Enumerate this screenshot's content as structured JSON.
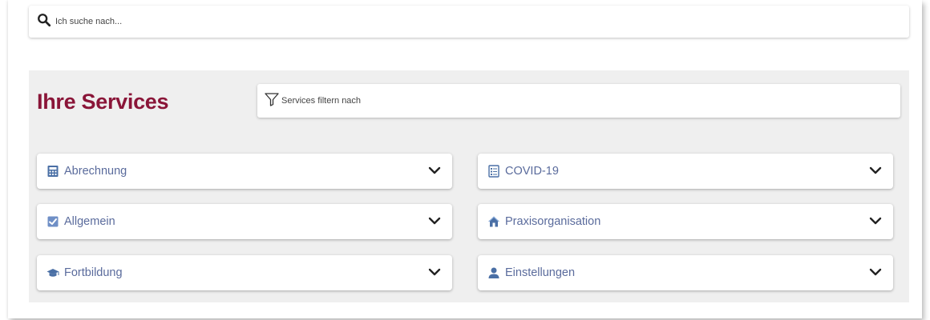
{
  "search": {
    "placeholder": "Ich suche nach..."
  },
  "services": {
    "title": "Ihre Services",
    "filter_placeholder": "Services filtern nach",
    "items": [
      {
        "label": "Abrechnung",
        "icon": "calculator-icon"
      },
      {
        "label": "COVID-19",
        "icon": "clipboard-list-icon"
      },
      {
        "label": "Allgemein",
        "icon": "checkbox-icon"
      },
      {
        "label": "Praxisorganisation",
        "icon": "home-icon"
      },
      {
        "label": "Fortbildung",
        "icon": "graduation-cap-icon"
      },
      {
        "label": "Einstellungen",
        "icon": "user-icon"
      }
    ]
  },
  "colors": {
    "title": "#8a1538",
    "label": "#5a6b9c",
    "icon": "#4a6fa5",
    "panel_bg": "#efefef"
  }
}
